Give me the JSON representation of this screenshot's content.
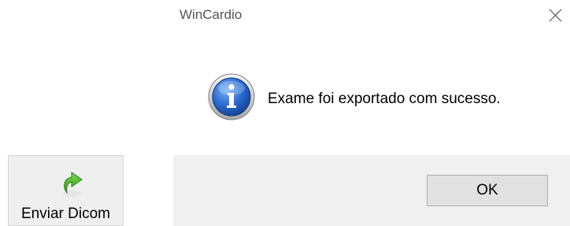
{
  "background_app": {
    "send_button": {
      "label": "Enviar Dicom",
      "icon": "green-arrow-send-icon"
    }
  },
  "dialog": {
    "title": "WinCardio",
    "close_icon": "close-icon",
    "message_icon": "info-icon",
    "message": "Exame foi exportado com sucesso.",
    "ok_label": "OK"
  },
  "colors": {
    "footer_bg": "#f0f0f0",
    "info_icon_blue": "#1f5fb8",
    "button_bg": "#e1e1e1",
    "send_icon_green": "#3fae2a"
  }
}
